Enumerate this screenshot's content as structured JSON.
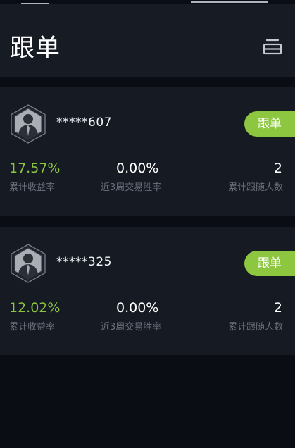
{
  "colors": {
    "background": "#0a0d13",
    "panel": "#161a23",
    "header": "#171b24",
    "accent_green": "#8dc63f",
    "label_gray": "#6b717c"
  },
  "header": {
    "title": "跟单",
    "menu_icon": "stack-menu-icon"
  },
  "cards": [
    {
      "avatar_icon": "user-avatar-hexagon-icon",
      "username": "*****607",
      "follow_label": "跟单",
      "stats": [
        {
          "value": "17.57%",
          "label": "累计收益率"
        },
        {
          "value": "0.00%",
          "label": "近3周交易胜率"
        },
        {
          "value": "2",
          "label": "累计跟随人数"
        }
      ]
    },
    {
      "avatar_icon": "user-avatar-hexagon-icon",
      "username": "*****325",
      "follow_label": "跟单",
      "stats": [
        {
          "value": "12.02%",
          "label": "累计收益率"
        },
        {
          "value": "0.00%",
          "label": "近3周交易胜率"
        },
        {
          "value": "2",
          "label": "累计跟随人数"
        }
      ]
    }
  ]
}
